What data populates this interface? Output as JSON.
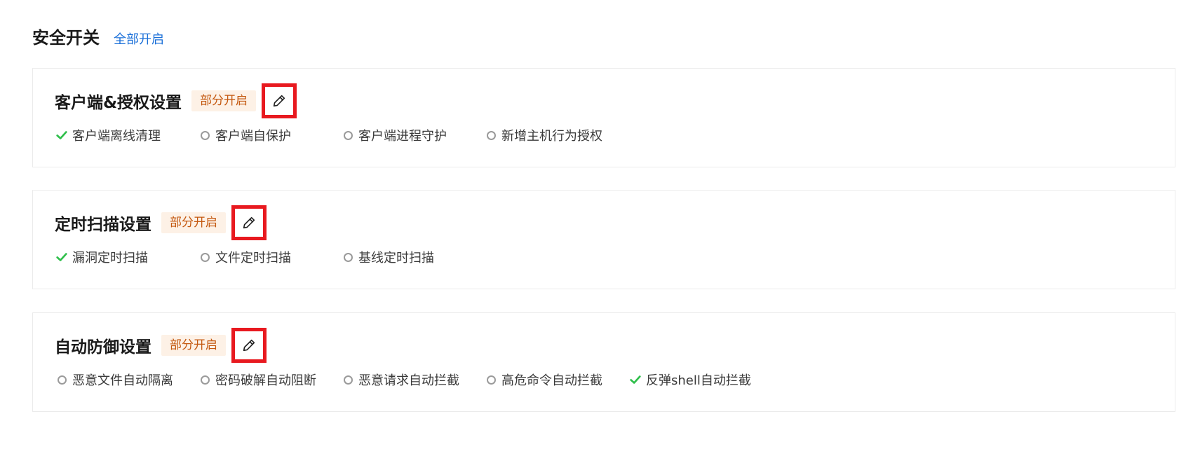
{
  "header": {
    "title": "安全开关",
    "enable_all_link": "全部开启"
  },
  "colors": {
    "accent_link": "#1a6fd8",
    "badge_bg": "#fdf1e6",
    "badge_text": "#c4580f",
    "check_green": "#2fbf4b",
    "highlight_red": "#e8191f"
  },
  "cards": [
    {
      "title": "客户端&授权设置",
      "status": "部分开启",
      "options": [
        {
          "label": "客户端离线清理",
          "enabled": true
        },
        {
          "label": "客户端自保护",
          "enabled": false
        },
        {
          "label": "客户端进程守护",
          "enabled": false
        },
        {
          "label": "新增主机行为授权",
          "enabled": false
        }
      ]
    },
    {
      "title": "定时扫描设置",
      "status": "部分开启",
      "options": [
        {
          "label": "漏洞定时扫描",
          "enabled": true
        },
        {
          "label": "文件定时扫描",
          "enabled": false
        },
        {
          "label": "基线定时扫描",
          "enabled": false
        }
      ]
    },
    {
      "title": "自动防御设置",
      "status": "部分开启",
      "options": [
        {
          "label": "恶意文件自动隔离",
          "enabled": false
        },
        {
          "label": "密码破解自动阻断",
          "enabled": false
        },
        {
          "label": "恶意请求自动拦截",
          "enabled": false
        },
        {
          "label": "高危命令自动拦截",
          "enabled": false
        },
        {
          "label": "反弹shell自动拦截",
          "enabled": true
        }
      ]
    }
  ]
}
